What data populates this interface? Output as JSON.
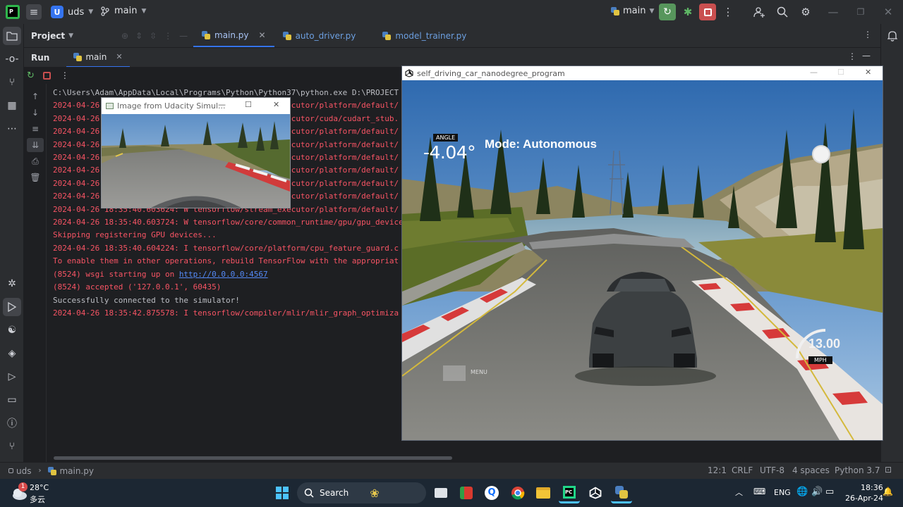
{
  "ide": {
    "project_badge": "U",
    "project_name": "uds",
    "branch": "main",
    "run_config": "main",
    "project_panel_label": "Project",
    "editor_tabs": [
      {
        "label": "main.py"
      },
      {
        "label": "auto_driver.py"
      },
      {
        "label": "model_trainer.py"
      }
    ],
    "run_tab_label": "Run",
    "run_config_tab": "main"
  },
  "console": {
    "lines": [
      {
        "text": "C:\\Users\\Adam\\AppData\\Local\\Programs\\Python\\Python37\\python.exe D:\\PROJECT",
        "kind": "gray"
      },
      {
        "text": "2024-04-26 18:35:40.603624: W tensorflow/stream_executor/platform/default/",
        "kind": "red"
      },
      {
        "text": "2024-04-26 18:35:40.603624: W tensorflow/stream_executor/cuda/cudart_stub.",
        "kind": "red"
      },
      {
        "text": "2024-04-26 18:35:40.603624: W tensorflow/stream_executor/platform/default/",
        "kind": "red"
      },
      {
        "text": "2024-04-26 18:35:40.603624: W tensorflow/stream_executor/platform/default/",
        "kind": "red"
      },
      {
        "text": "2024-04-26 18:35:40.603624: W tensorflow/stream_executor/platform/default/",
        "kind": "red"
      },
      {
        "text": "2024-04-26 18:35:40.603624: W tensorflow/stream_executor/platform/default/",
        "kind": "red"
      },
      {
        "text": "2024-04-26 18:35:40.603624: W tensorflow/stream_executor/platform/default/",
        "kind": "red"
      },
      {
        "text": "2024-04-26 18:35:40.603624: W tensorflow/stream_executor/platform/default/",
        "kind": "red"
      },
      {
        "text": "2024-04-26 18:35:40.603624: W tensorflow/stream_executor/platform/default/",
        "kind": "red"
      },
      {
        "text": "2024-04-26 18:35:40.603724: W tensorflow/core/common_runtime/gpu/gpu_device",
        "kind": "red"
      },
      {
        "text": "Skipping registering GPU devices...",
        "kind": "red"
      },
      {
        "text": "2024-04-26 18:35:40.604224: I tensorflow/core/platform/cpu_feature_guard.c",
        "kind": "red"
      },
      {
        "text": "To enable them in other operations, rebuild TensorFlow with the appropriat",
        "kind": "red"
      },
      {
        "text": "(8524) wsgi starting up on ",
        "kind": "red",
        "link": "http://0.0.0.0:4567"
      },
      {
        "text": "(8524) accepted ('127.0.0.1', 60435)",
        "kind": "red"
      },
      {
        "text": "Successfully connected to the simulator!",
        "kind": "gray"
      },
      {
        "text": "2024-04-26 18:35:42.875578: I tensorflow/compiler/mlir/mlir_graph_optimiza",
        "kind": "red"
      }
    ]
  },
  "camera_window": {
    "title": "Image from Udacity Simul..."
  },
  "simulator": {
    "title": "self_driving_car_nanodegree_program",
    "angle_label": "ANGLE",
    "angle_value": "-4.04°",
    "mode_text": "Mode: Autonomous",
    "speed_value": "13.00",
    "speed_unit": "MPH",
    "menu_label": "MENU"
  },
  "statusbar": {
    "project": "uds",
    "file": "main.py",
    "position": "12:1",
    "line_sep": "CRLF",
    "encoding": "UTF-8",
    "indent": "4 spaces",
    "interpreter": "Python 3.7"
  },
  "taskbar": {
    "temp": "28°C",
    "weather": "多云",
    "weather_badge": "1",
    "search_label": "Search",
    "lang": "ENG",
    "time": "18:36",
    "date": "26-Apr-24"
  },
  "colors": {
    "accent": "#3574f0",
    "run_green": "#57965c",
    "stop_red": "#c94f4f",
    "console_error": "#f75464"
  }
}
